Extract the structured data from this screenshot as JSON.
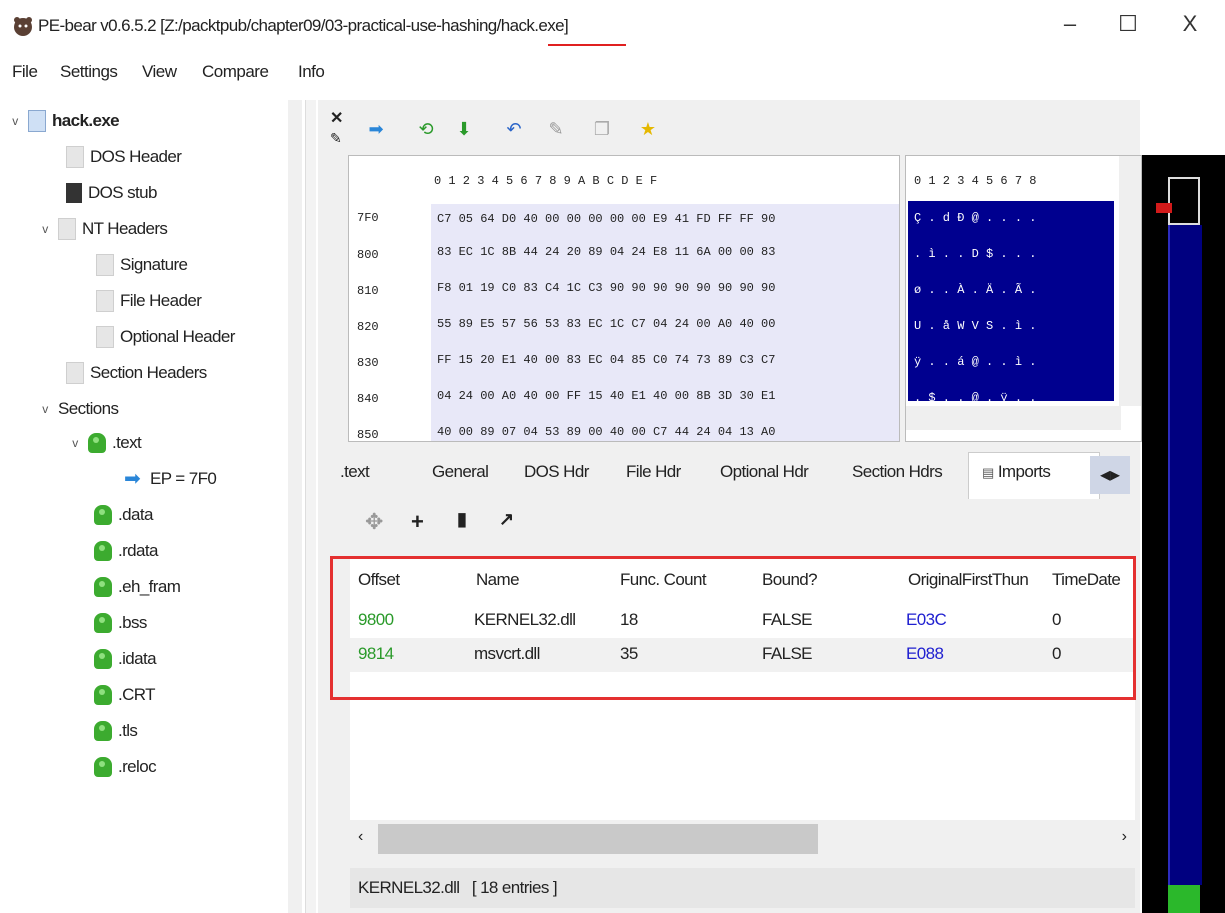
{
  "window": {
    "title": "PE-bear v0.6.5.2 [Z:/packtpub/chapter09/03-practical-use-hashing/hack.exe]",
    "minimize": "–",
    "maximize": "☐",
    "close": "X"
  },
  "menu": [
    "File",
    "Settings",
    "View",
    "Compare",
    "Info"
  ],
  "tree": {
    "root": "hack.exe",
    "dos_header": "DOS Header",
    "dos_stub": "DOS stub",
    "nt_headers": "NT Headers",
    "signature": "Signature",
    "file_header": "File Header",
    "optional_header": "Optional Header",
    "section_headers": "Section Headers",
    "sections": "Sections",
    "text": ".text",
    "ep": "EP = 7F0",
    "data": ".data",
    "rdata": ".rdata",
    "eh_fram": ".eh_fram",
    "bss": ".bss",
    "idata": ".idata",
    "crt": ".CRT",
    "tls": ".tls",
    "reloc": ".reloc"
  },
  "hex": {
    "header": "0 1 2 3 4 5 6 7 8 9 A B C D E F",
    "ascii_header": "0 1 2 3 4 5 6 7 8",
    "rows": [
      {
        "addr": "7F0",
        "bytes": "C7 05 64 D0 40 00 00 00 00 00 E9 41 FD FF FF 90"
      },
      {
        "addr": "800",
        "bytes": "83 EC 1C 8B 44 24 20 89 04 24 E8 11 6A 00 00 83"
      },
      {
        "addr": "810",
        "bytes": "F8 01 19 C0 83 C4 1C C3 90 90 90 90 90 90 90 90"
      },
      {
        "addr": "820",
        "bytes": "55 89 E5 57 56 53 83 EC 1C C7 04 24 00 A0 40 00"
      },
      {
        "addr": "830",
        "bytes": "FF 15 20 E1 40 00 83 EC 04 85 C0 74 73 89 C3 C7"
      },
      {
        "addr": "840",
        "bytes": "04 24 00 A0 40 00 FF 15 40 E1 40 00 8B 3D 30 E1"
      },
      {
        "addr": "850",
        "bytes": "40 00 89 07 04 53 89 00 40 00 C7 44 24 04 13 A0"
      }
    ],
    "ascii_rows": [
      "Ç . d Ð @ . . . .",
      ". ì . . D $ . . .",
      "ø . . À . Ä . Ã .",
      "U . å W V S . ì .",
      "ÿ . . á @ . . ì .",
      ". $ . . @ . ÿ . ."
    ]
  },
  "tabs": [
    ".text",
    "General",
    "DOS Hdr",
    "File Hdr",
    "Optional Hdr",
    "Section Hdrs",
    "Imports"
  ],
  "imports": {
    "columns": [
      "Offset",
      "Name",
      "Func. Count",
      "Bound?",
      "OriginalFirstThun",
      "TimeDate"
    ],
    "rows": [
      {
        "offset": "9800",
        "name": "KERNEL32.dll",
        "count": "18",
        "bound": "FALSE",
        "oft": "E03C",
        "timedate": "0"
      },
      {
        "offset": "9814",
        "name": "msvcrt.dll",
        "count": "35",
        "bound": "FALSE",
        "oft": "E088",
        "timedate": "0"
      }
    ]
  },
  "status": "KERNEL32.dll   [ 18 entries ]",
  "colors": {
    "offset": "#2a9a2a",
    "link": "#2020d0",
    "highlight_border": "#e43030",
    "selection": "#00008f"
  }
}
